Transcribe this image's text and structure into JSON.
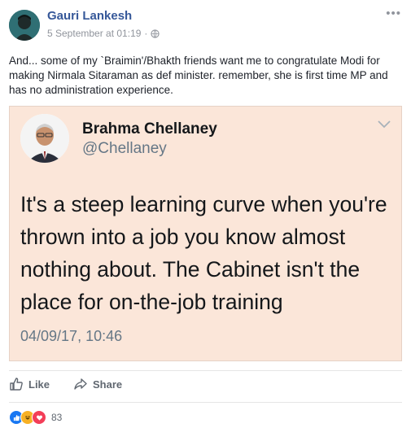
{
  "post": {
    "author": "Gauri Lankesh",
    "timestamp": "5 September at 01:19",
    "separator": "·",
    "more_icon": "•••",
    "text": "And... some of my `Braimin'/Bhakth friends want me to congratulate Modi for making Nirmala Sitaraman as def minister. remember, she is first time MP and has no administration experience."
  },
  "tweet": {
    "name": "Brahma Chellaney",
    "handle": "@Chellaney",
    "text": "It's a steep learning curve when you're thrown into a job you know almost nothing about. The Cabinet isn't the place for on-the-job training",
    "time": "04/09/17, 10:46"
  },
  "actions": {
    "like_label": "Like",
    "share_label": "Share"
  },
  "reactions": {
    "count": "83",
    "types": [
      "like",
      "haha",
      "love"
    ]
  },
  "colors": {
    "author_link": "#365899",
    "tweet_bg": "#fbe6d9",
    "like_blue": "#1877f2",
    "love_red": "#f33e58",
    "haha_yellow": "#f7b125"
  }
}
